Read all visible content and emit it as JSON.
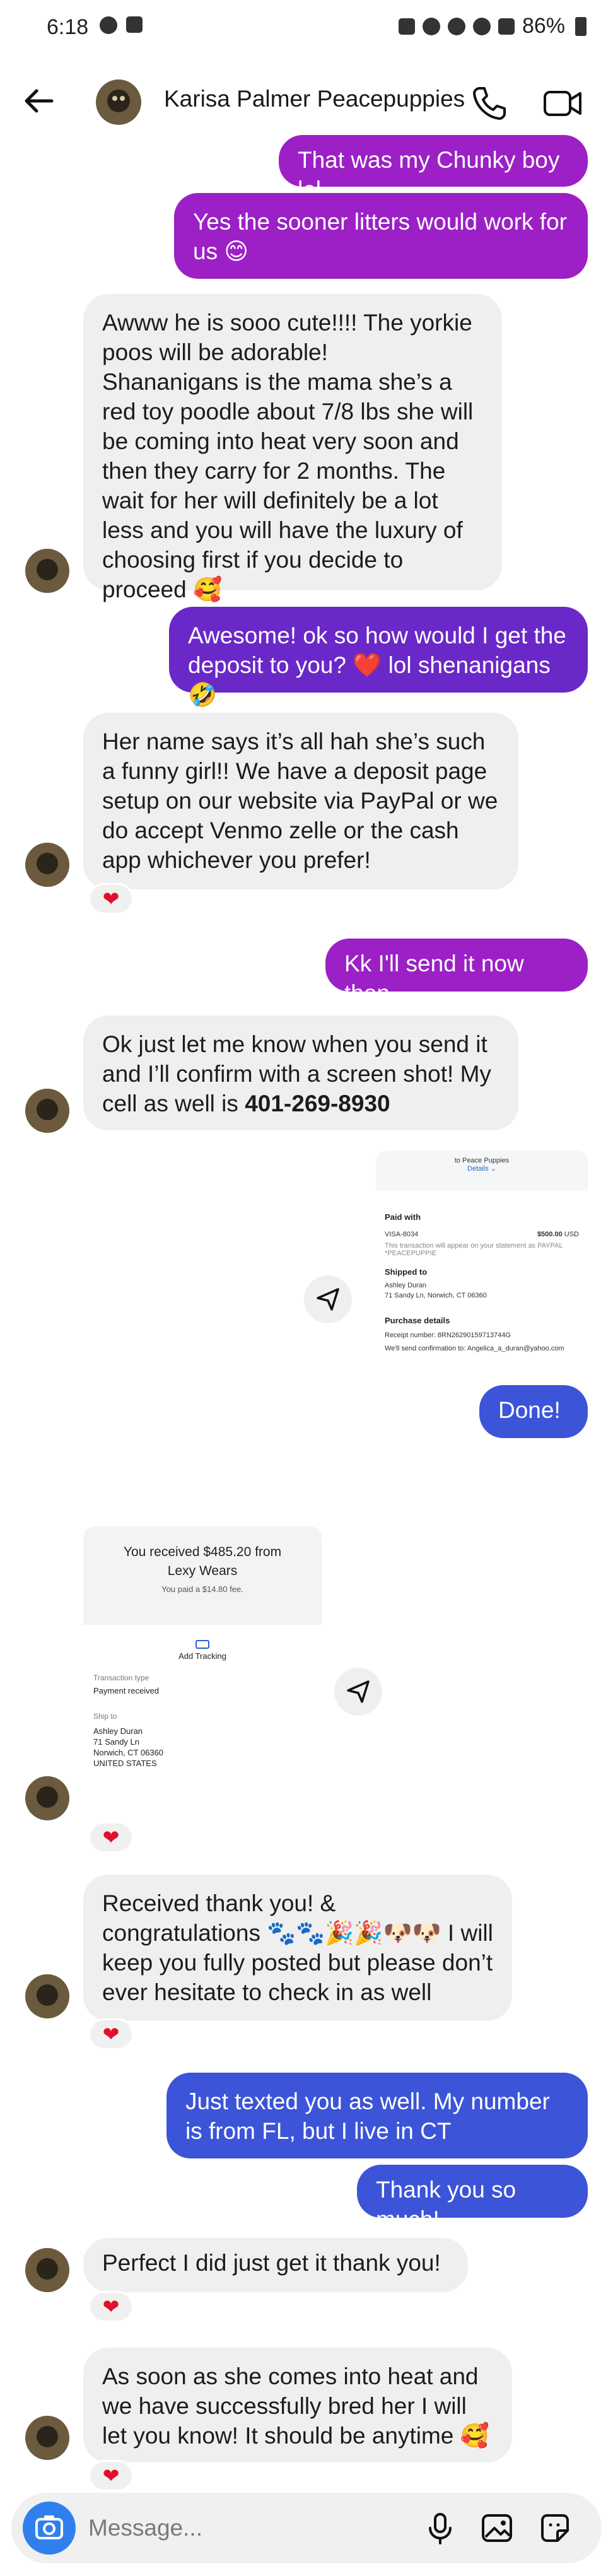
{
  "status_bar": {
    "time": "6:18",
    "battery": "86%"
  },
  "header": {
    "contact_name": "Karisa Palmer Peacepuppies"
  },
  "messages": [
    {
      "text": "That was my Chunky boy lol"
    },
    {
      "text": "Yes the sooner litters would work for us 😊"
    },
    {
      "text": "Awww he is sooo cute!!!! The yorkie poos will be adorable!\nShananigans is the mama she’s a red toy poodle about 7/8 lbs she will be coming into heat very soon and then they carry for 2 months. The wait for her will definitely be a lot less and you will have the luxury of choosing first if you decide to proceed 🥰"
    },
    {
      "text": "Awesome!  ok so how would I get the deposit to you? ❤️ lol shenanigans 🤣"
    },
    {
      "text": "Her name says it’s all hah she’s such a funny girl!! We have a deposit page setup on our website via PayPal or we do accept Venmo  zelle or the cash app whichever you prefer!"
    },
    {
      "text": "Kk I'll send it now then"
    },
    {
      "text": "Ok just let me know when you send it and I’ll confirm with a screen shot! My cell as well is ",
      "phone": "401-269-8930"
    },
    {
      "text": "Done!"
    },
    {
      "text": "Received thank you! & congratulations 🐾🐾🎉🎉🐶🐶 I will keep you fully posted but please don’t ever hesitate to check in as well"
    },
    {
      "text": "Just texted you as well. My number is from FL,  but I live in CT"
    },
    {
      "text": "Thank you so much!"
    },
    {
      "text": "Perfect I did just get it thank you!"
    },
    {
      "text": "As soon as she comes into heat and we have successfully bred her I will let you know! It should be anytime 🥰"
    }
  ],
  "reaction": "❤",
  "attachment_paypal": {
    "to_label": "to Peace Puppies",
    "details": "Details ⌄",
    "paid_with": "Paid with",
    "card": "VISA-8034",
    "amount": "$500.00",
    "currency": "USD",
    "statement_note": "This transaction will appear on your statement as PAYPAL *PEACEPUPPIE",
    "shipped_to": "Shipped to",
    "ship_name": "Ashley Duran",
    "ship_address": "71 Sandy Ln, Norwich, CT 06360",
    "purchase_details": "Purchase details",
    "receipt": "Receipt number: 8RN26290159713744G",
    "confirmation": "We'll send confirmation to: Angelica_a_duran@yahoo.com"
  },
  "attachment_received": {
    "title": "You received $485.20 from Lexy Wears",
    "fee": "You paid a $14.80 fee.",
    "add_tracking": "Add Tracking",
    "transaction_type_label": "Transaction type",
    "transaction_type": "Payment received",
    "ship_to_label": "Ship to",
    "ship_lines": [
      "Ashley Duran",
      "71 Sandy Ln",
      "Norwich, CT 06360",
      "UNITED STATES"
    ]
  },
  "composer": {
    "placeholder": "Message..."
  },
  "colors": {
    "outgoing_purple": "#9c20c6",
    "outgoing_violet": "#6a28c8",
    "outgoing_blue": "#3c54d8",
    "incoming": "#efefef",
    "camera": "#2f80ed",
    "heart": "#e0102c"
  }
}
